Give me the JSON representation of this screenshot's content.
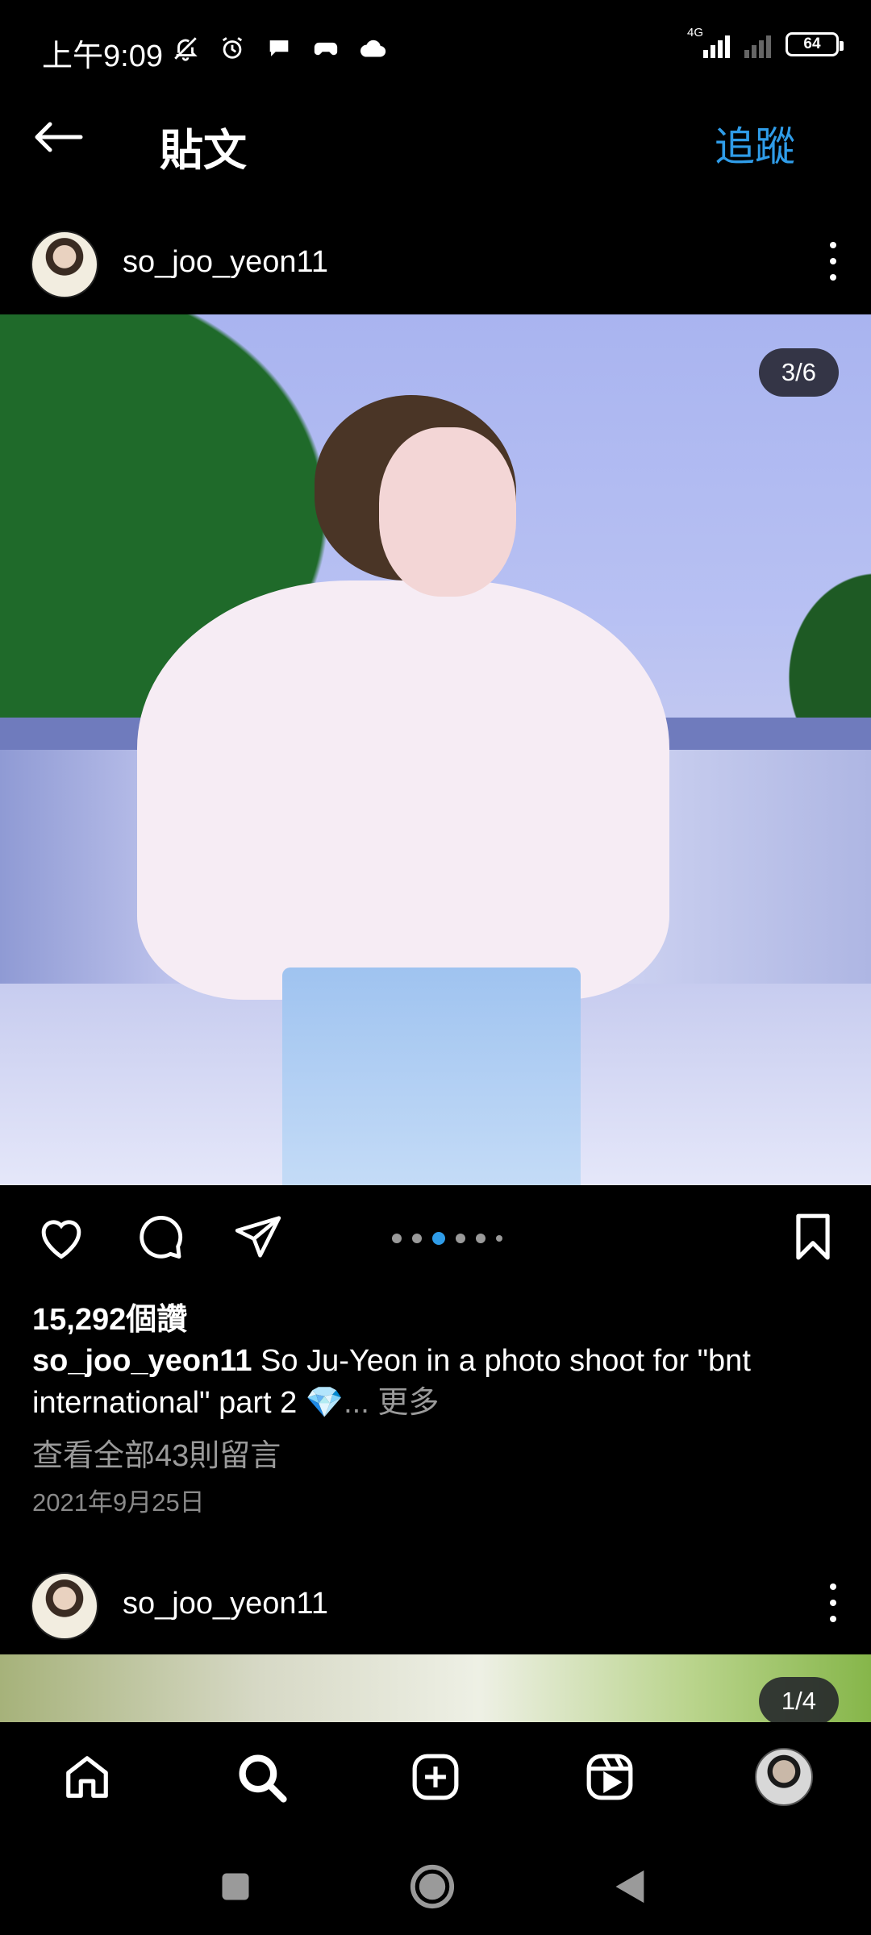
{
  "status_bar": {
    "time": "上午9:09",
    "network": "4G",
    "battery": "64",
    "icons": [
      "bell-off-icon",
      "alarm-icon",
      "chat-bubble-icon",
      "game-controller-icon",
      "cloud-icon"
    ]
  },
  "header": {
    "title": "貼文",
    "follow_label": "追蹤"
  },
  "post": {
    "username": "so_joo_yeon11",
    "image_counter": "3/6",
    "carousel": {
      "total_dots": 6,
      "active_index": 2
    },
    "likes": "15,292個讚",
    "caption_user": "so_joo_yeon11",
    "caption_text": " So Ju-Yeon in a photo shoot for \"bnt international\" part 2 💎",
    "caption_more": "... 更多",
    "comments_link": "查看全部43則留言",
    "date": "2021年9月25日"
  },
  "next_post": {
    "username": "so_joo_yeon11",
    "image_counter": "1/4"
  },
  "colors": {
    "accent": "#2f9ce8",
    "background": "#000000",
    "secondary_text": "#9a9a9a"
  }
}
